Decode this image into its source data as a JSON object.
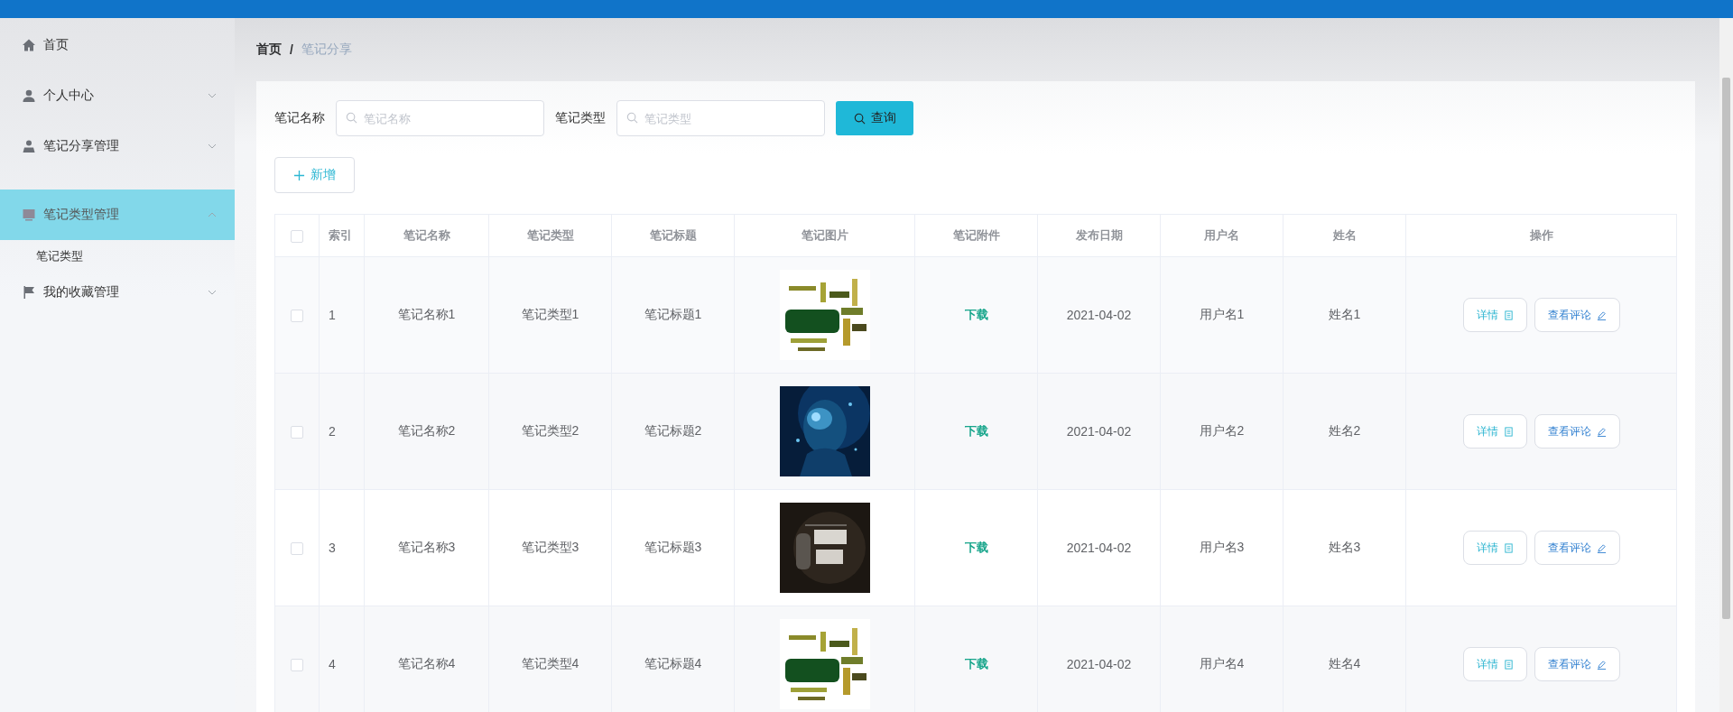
{
  "sidebar": {
    "items": [
      {
        "label": "首页",
        "selected": false
      },
      {
        "label": "个人中心",
        "selected": false,
        "expanded": false
      },
      {
        "label": "笔记分享管理",
        "selected": false,
        "expanded": false
      },
      {
        "label": "笔记类型管理",
        "selected": true,
        "expanded": true,
        "children": [
          {
            "label": "笔记类型",
            "selected": false
          }
        ]
      },
      {
        "label": "我的收藏管理",
        "selected": false,
        "expanded": false
      }
    ]
  },
  "breadcrumb": {
    "items": [
      "首页",
      "笔记分享"
    ],
    "separator": "/"
  },
  "search": {
    "fields": [
      {
        "label": "笔记名称",
        "placeholder": "笔记名称"
      },
      {
        "label": "笔记类型",
        "placeholder": "笔记类型"
      }
    ],
    "button": "查询"
  },
  "add_button": "新增",
  "table": {
    "header_checked": false,
    "columns": [
      "索引",
      "笔记名称",
      "笔记类型",
      "笔记标题",
      "笔记图片",
      "笔记附件",
      "发布日期",
      "用户名",
      "姓名",
      "操作"
    ],
    "rows": [
      {
        "checked": false,
        "index": "1",
        "name": "笔记名称1",
        "type": "笔记类型1",
        "title": "笔记标题1",
        "attachment": "下载",
        "date": "2021-04-02",
        "username": "用户名1",
        "real_name": "姓名1",
        "actions": [
          "详情",
          "查看评论"
        ]
      },
      {
        "checked": false,
        "index": "2",
        "name": "笔记名称2",
        "type": "笔记类型2",
        "title": "笔记标题2",
        "attachment": "下载",
        "date": "2021-04-02",
        "username": "用户名2",
        "real_name": "姓名2",
        "actions": [
          "详情",
          "查看评论"
        ]
      },
      {
        "checked": false,
        "index": "3",
        "name": "笔记名称3",
        "type": "笔记类型3",
        "title": "笔记标题3",
        "attachment": "下载",
        "date": "2021-04-02",
        "username": "用户名3",
        "real_name": "姓名3",
        "actions": [
          "详情",
          "查看评论"
        ]
      },
      {
        "checked": false,
        "index": "4",
        "name": "笔记名称4",
        "type": "笔记类型4",
        "title": "笔记标题4",
        "attachment": "下载",
        "date": "2021-04-02",
        "username": "用户名4",
        "real_name": "姓名4",
        "actions": [
          "详情",
          "查看评论"
        ]
      }
    ]
  }
}
